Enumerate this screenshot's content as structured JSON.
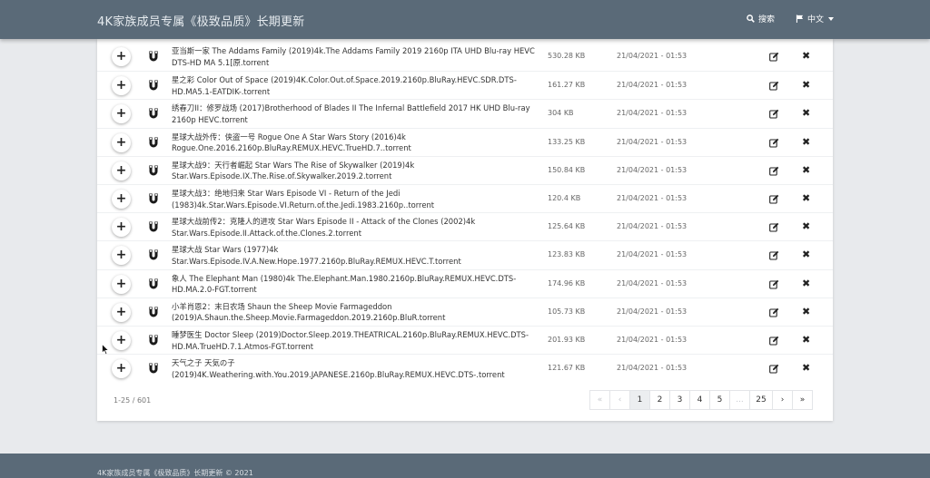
{
  "navbar": {
    "title": "4K家族成员专属《极致品质》长期更新",
    "search_label": "搜索",
    "lang_label": "中文"
  },
  "rows": [
    {
      "name": "亚当斯一家 The Addams Family (2019)4k.The Addams Family 2019 2160p ITA UHD Blu-ray HEVC DTS-HD MA 5.1[原.torrent",
      "size": "530.28 KB",
      "date": "21/04/2021 - 01:53"
    },
    {
      "name": "星之彩 Color Out of Space (2019)4K.Color.Out.of.Space.2019.2160p.BluRay.HEVC.SDR.DTS-HD.MA5.1-EATDIK-.torrent",
      "size": "161.27 KB",
      "date": "21/04/2021 - 01:53"
    },
    {
      "name": "绣春刀II：修罗战场 (2017)Brotherhood of Blades II The Infernal Battlefield 2017 HK UHD Blu-ray 2160p HEVC.torrent",
      "size": "304 KB",
      "date": "21/04/2021 - 01:53"
    },
    {
      "name": "星球大战外传：侠盗一号 Rogue One A Star Wars Story (2016)4k Rogue.One.2016.2160p.BluRay.REMUX.HEVC.TrueHD.7..torrent",
      "size": "133.25 KB",
      "date": "21/04/2021 - 01:53"
    },
    {
      "name": "星球大战9：天行者崛起 Star Wars The Rise of Skywalker (2019)4k Star.Wars.Episode.IX.The.Rise.of.Skywalker.2019.2.torrent",
      "size": "150.84 KB",
      "date": "21/04/2021 - 01:53"
    },
    {
      "name": "星球大战3：绝地归来 Star Wars Episode VI - Return of the Jedi (1983)4k.Star.Wars.Episode.VI.Return.of.the.Jedi.1983.2160p..torrent",
      "size": "120.4 KB",
      "date": "21/04/2021 - 01:53"
    },
    {
      "name": "星球大战前传2：克隆人的进攻 Star Wars Episode II - Attack of the Clones (2002)4k Star.Wars.Episode.II.Attack.of.the.Clones.2.torrent",
      "size": "125.64 KB",
      "date": "21/04/2021 - 01:53"
    },
    {
      "name": "星球大战 Star Wars (1977)4k Star.Wars.Episode.IV.A.New.Hope.1977.2160p.BluRay.REMUX.HEVC.T.torrent",
      "size": "123.83 KB",
      "date": "21/04/2021 - 01:53"
    },
    {
      "name": "象人 The Elephant Man (1980)4k The.Elephant.Man.1980.2160p.BluRay.REMUX.HEVC.DTS-HD.MA.2.0-FGT.torrent",
      "size": "174.96 KB",
      "date": "21/04/2021 - 01:53"
    },
    {
      "name": "小羊肖恩2：末日农场 Shaun the Sheep Movie Farmageddon (2019)A.Shaun.the.Sheep.Movie.Farmageddon.2019.2160p.BluR.torrent",
      "size": "105.73 KB",
      "date": "21/04/2021 - 01:53"
    },
    {
      "name": "睡梦医生 Doctor Sleep (2019)Doctor.Sleep.2019.THEATRICAL.2160p.BluRay.REMUX.HEVC.DTS-HD.MA.TrueHD.7.1.Atmos-FGT.torrent",
      "size": "201.93 KB",
      "date": "21/04/2021 - 01:53"
    },
    {
      "name": "天气之子 天気の子 (2019)4K.Weathering.with.You.2019.JAPANESE.2160p.BluRay.REMUX.HEVC.DTS-.torrent",
      "size": "121.67 KB",
      "date": "21/04/2021 - 01:53"
    }
  ],
  "pagination": {
    "count": "1-25 / 601",
    "first": "«",
    "prev": "‹",
    "pages": [
      "1",
      "2",
      "3",
      "4",
      "5",
      "...",
      "25"
    ],
    "next": "›",
    "last": "»",
    "current": "1"
  },
  "footer": {
    "text": "4K家族成员专属《极致品质》长期更新 © 2021"
  },
  "colors": {
    "navbar": "#5a6a78",
    "background": "#e8eaed",
    "panel": "#ffffff"
  },
  "icons": {
    "add": "plus-icon",
    "magnet": "magnet-icon",
    "edit": "edit-icon",
    "delete": "close-icon",
    "search": "search-icon",
    "lang": "flag-icon"
  }
}
